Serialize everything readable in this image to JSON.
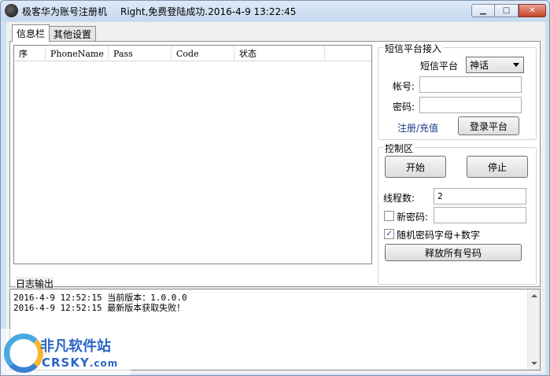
{
  "window": {
    "title": "极客华为账号注册机",
    "status": "Right,免费登陆成功.2016-4-9 13:22:45",
    "minimize_glyph": "▁",
    "maximize_glyph": "□",
    "close_glyph": "✕"
  },
  "tabs": [
    {
      "label": "信息栏",
      "active": true
    },
    {
      "label": "其他设置",
      "active": false
    }
  ],
  "table": {
    "columns": [
      "序",
      "PhoneName",
      "Pass",
      "Code",
      "状态"
    ],
    "rows": []
  },
  "sms_platform": {
    "group_title": "短信平台接入",
    "platform_label": "短信平台",
    "platform_value": "神话",
    "account_label": "帐号:",
    "account_value": "",
    "password_label": "密码:",
    "password_value": "",
    "register_link": "注册/充值",
    "login_button": "登录平台"
  },
  "control": {
    "group_title": "控制区",
    "start_button": "开始",
    "stop_button": "停止",
    "threads_label": "线程数:",
    "threads_value": "2",
    "new_password_label": "新密码:",
    "new_password_checked": false,
    "new_password_value": "",
    "random_password_label": "随机密码字母+数字",
    "random_password_checked": true,
    "check_glyph": "✓",
    "release_button": "释放所有号码"
  },
  "log": {
    "title": "日志输出",
    "lines": [
      "2016-4-9 12:52:15 当前版本：1.0.0.0",
      "2016-4-9 12:52:15 最新版本获取失败！"
    ]
  },
  "watermark": {
    "name": "非凡软件站",
    "site": "CRSKY",
    "site_suffix": ".com"
  },
  "icons": {
    "app": "app-icon",
    "minimize": "minimize-icon",
    "maximize": "maximize-icon",
    "close": "close-icon",
    "dropdown": "chevron-down-icon"
  }
}
